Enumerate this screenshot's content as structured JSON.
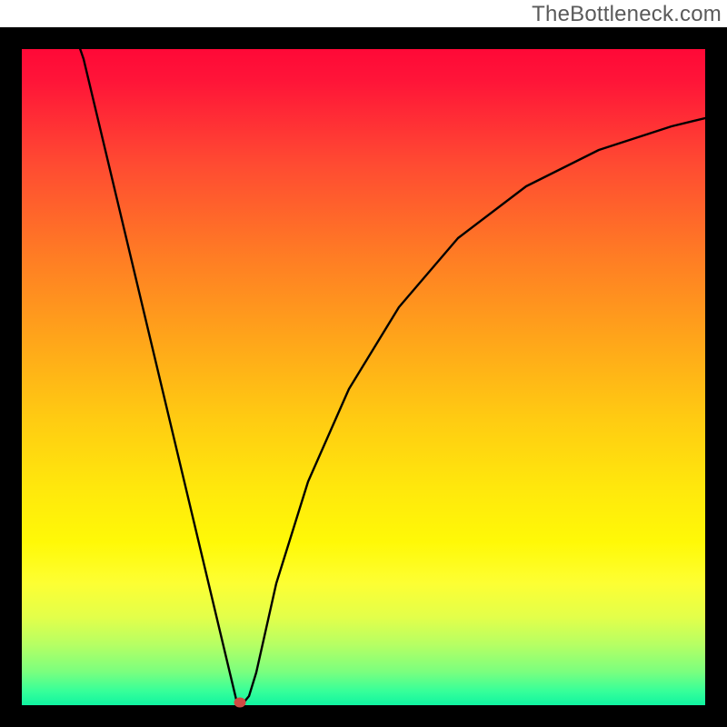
{
  "watermark": {
    "text": "TheBottleneck.com"
  },
  "colors": {
    "frame": "#000000",
    "curve": "#000000",
    "marker": "#d04a43",
    "gradient_stops": [
      "#ff0036",
      "#ff7d24",
      "#ffe80c",
      "#35ff9a",
      "#10f4a0"
    ]
  },
  "chart_data": {
    "type": "line",
    "title": "",
    "xlabel": "",
    "ylabel": "",
    "xlim": [
      0,
      100
    ],
    "ylim": [
      0,
      100
    ],
    "grid": false,
    "legend": false,
    "background": "vertical-gradient red→green (bottleneck severity heatmap)",
    "note": "No visible axis ticks or numeric labels; values estimated from pixel positions and normalized to [0,100]",
    "series": [
      {
        "name": "bottleneck-curve",
        "x": [
          0,
          3,
          6,
          9,
          12,
          15,
          18,
          21,
          24,
          27,
          30,
          31.5,
          33,
          36,
          40,
          45,
          52,
          60,
          70,
          80,
          90,
          100
        ],
        "values": [
          100,
          91,
          82,
          73,
          64,
          55,
          46,
          37,
          27,
          18,
          9,
          0.5,
          2,
          15,
          31,
          45,
          57,
          66,
          74,
          79,
          82,
          84
        ]
      }
    ],
    "marker": {
      "x": 31.5,
      "y": 0.5,
      "meaning": "optimal point (minimum bottleneck)"
    }
  }
}
